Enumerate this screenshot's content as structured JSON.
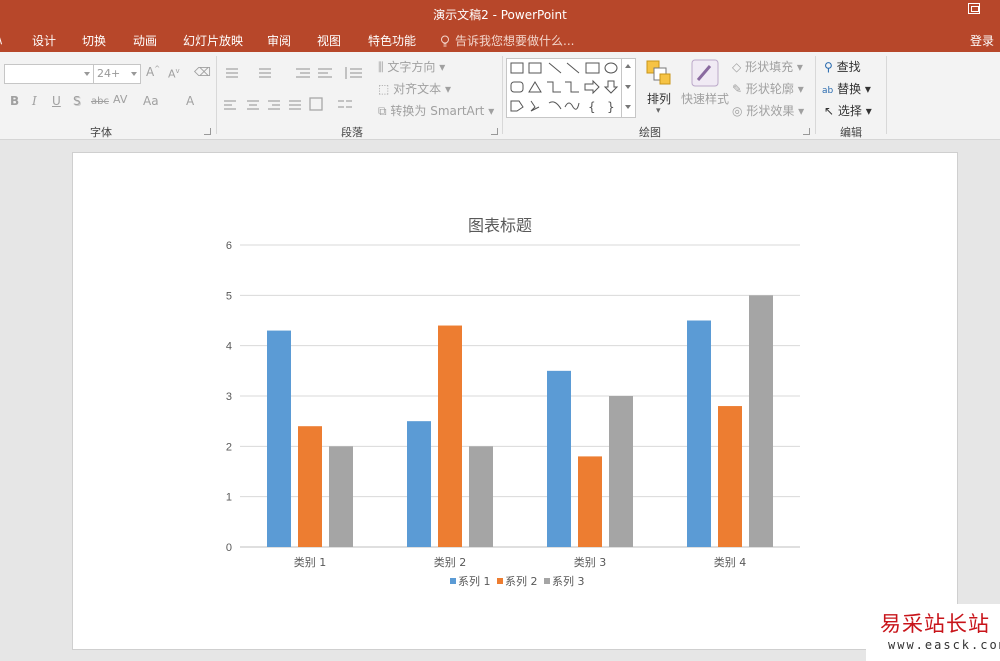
{
  "window": {
    "title": "演示文稿2 - PowerPoint"
  },
  "tabs": [
    {
      "label": "\\",
      "x": 0
    },
    {
      "label": "设计"
    },
    {
      "label": "切换"
    },
    {
      "label": "动画"
    },
    {
      "label": "幻灯片放映"
    },
    {
      "label": "审阅"
    },
    {
      "label": "视图"
    },
    {
      "label": "特色功能"
    }
  ],
  "tell_me": "告诉我您想要做什么...",
  "login": "登录",
  "ribbon": {
    "font": {
      "group_label": "字体",
      "font_name": "",
      "font_size": "24+",
      "buttons": [
        "B",
        "I",
        "U",
        "S",
        "abc",
        "AV",
        "Aa",
        "A"
      ]
    },
    "paragraph": {
      "group_label": "段落",
      "text_direction": "文字方向",
      "align_text": "对齐文本",
      "convert_smartart": "转换为 SmartArt"
    },
    "drawing": {
      "group_label": "绘图",
      "arrange": "排列",
      "quick_styles": "快速样式",
      "shape_fill": "形状填充",
      "shape_outline": "形状轮廓",
      "shape_effects": "形状效果"
    },
    "editing": {
      "group_label": "编辑",
      "find": "查找",
      "replace": "替换",
      "select": "选择"
    }
  },
  "chart_data": {
    "type": "bar",
    "title": "图表标题",
    "categories": [
      "类别 1",
      "类别 2",
      "类别 3",
      "类别 4"
    ],
    "series": [
      {
        "name": "系列 1",
        "values": [
          4.3,
          2.5,
          3.5,
          4.5
        ],
        "color": "#5b9bd5"
      },
      {
        "name": "系列 2",
        "values": [
          2.4,
          4.4,
          1.8,
          2.8
        ],
        "color": "#ed7d31"
      },
      {
        "name": "系列 3",
        "values": [
          2,
          2,
          3,
          5
        ],
        "color": "#a5a5a5"
      }
    ],
    "ylim": [
      0,
      6
    ],
    "yticks": [
      0,
      1,
      2,
      3,
      4,
      5,
      6
    ],
    "grid": true,
    "legend": "bottom"
  },
  "watermark": {
    "text": "易采站长站",
    "url": "www.easck.com"
  }
}
